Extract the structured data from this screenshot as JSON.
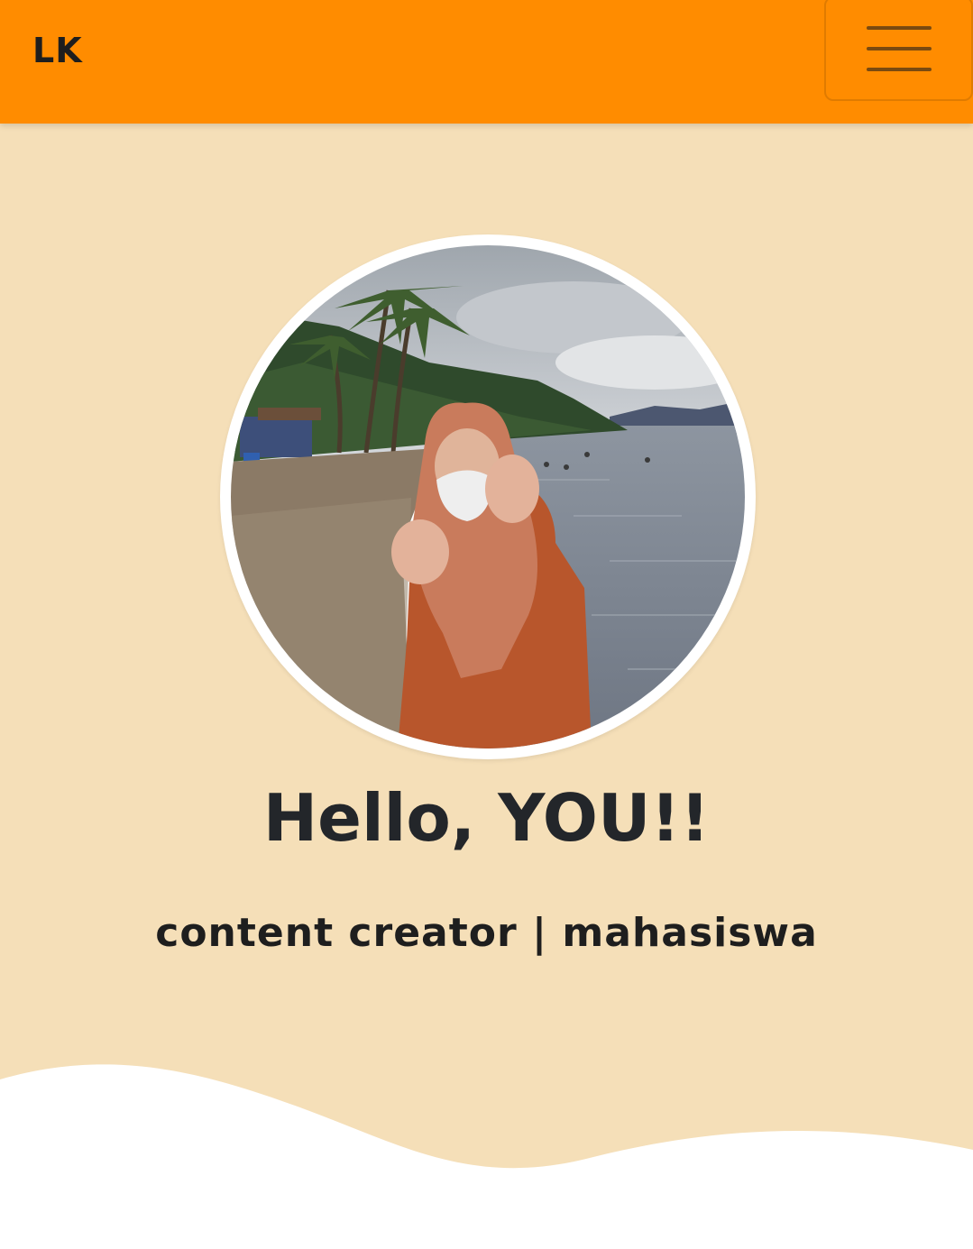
{
  "navbar": {
    "brand": "LK",
    "menu_icon": "hamburger-menu-icon",
    "background": "#ff8c00"
  },
  "hero": {
    "title": "Hello, YOU!!",
    "subtitle": "content creator | mahasiswa",
    "profile_image": "profile-photo",
    "background": "#f5dfb8"
  },
  "colors": {
    "accent": "#ff8c00",
    "page_bg": "#f5dfb8",
    "text": "#23262a",
    "wave": "#ffffff"
  }
}
